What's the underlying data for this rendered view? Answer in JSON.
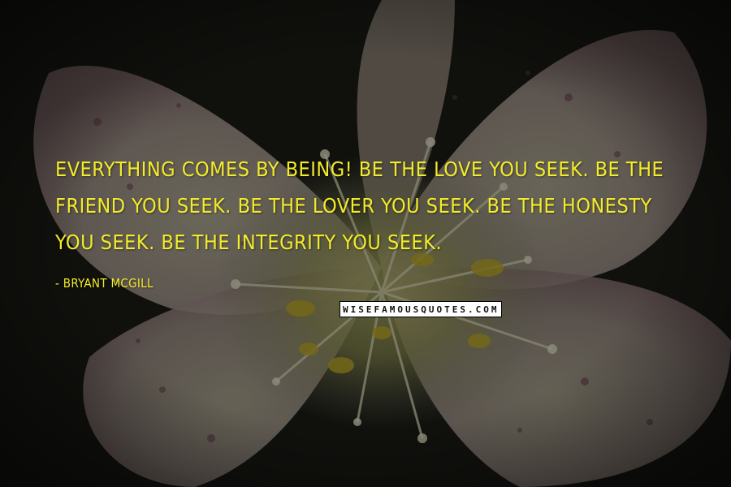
{
  "quote": {
    "text": "Everything comes by being! Be the love you seek. Be the friend you seek. Be the lover you seek. Be the honesty you seek. Be the integrity you seek.",
    "author": "- Bryant McGill",
    "watermark": "WISEFAMOUSQUOTES.COM"
  },
  "colors": {
    "text": "#f2ec2a",
    "background": "#1c1d18",
    "petal": "#b8a59c",
    "flower_center": "#c8c24a"
  },
  "background_image": "flower-photo"
}
